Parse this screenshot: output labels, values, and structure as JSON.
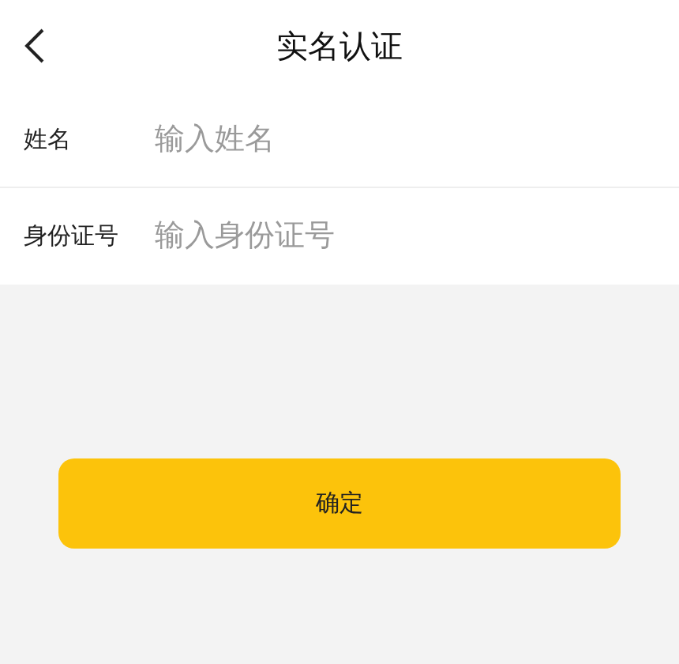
{
  "header": {
    "title": "实名认证"
  },
  "fields": [
    {
      "label": "姓名",
      "placeholder": "输入姓名"
    },
    {
      "label": "身份证号",
      "placeholder": "输入身份证号"
    }
  ],
  "confirm_button": {
    "label": "确定"
  }
}
